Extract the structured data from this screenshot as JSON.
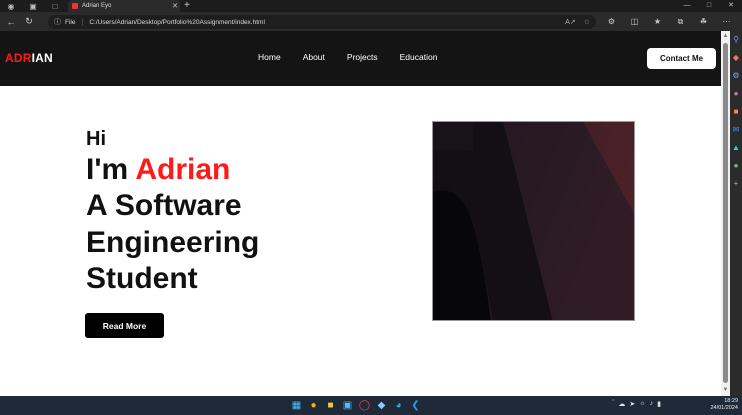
{
  "browser": {
    "tab_title": "Adrian Eyo",
    "address_scheme": "File",
    "url": "C:/Users/Adrian/Desktop/Portfolio%20Assignment/index.html"
  },
  "site": {
    "logo_red": "ADR",
    "logo_white": "IAN",
    "nav_links": [
      "Home",
      "About",
      "Projects",
      "Education"
    ],
    "contact_label": "Contact Me",
    "hero": {
      "greeting": "Hi",
      "intro_prefix": "I'm ",
      "intro_name": "Adrian",
      "line2": "A Software",
      "line3": "Engineering",
      "line4": "Student"
    },
    "read_more_label": "Read More"
  },
  "taskbar": {
    "time": "18:29",
    "date": "24/01/2024"
  },
  "colors": {
    "accent_red": "#ff1a1a",
    "nav_bg": "#141414"
  }
}
